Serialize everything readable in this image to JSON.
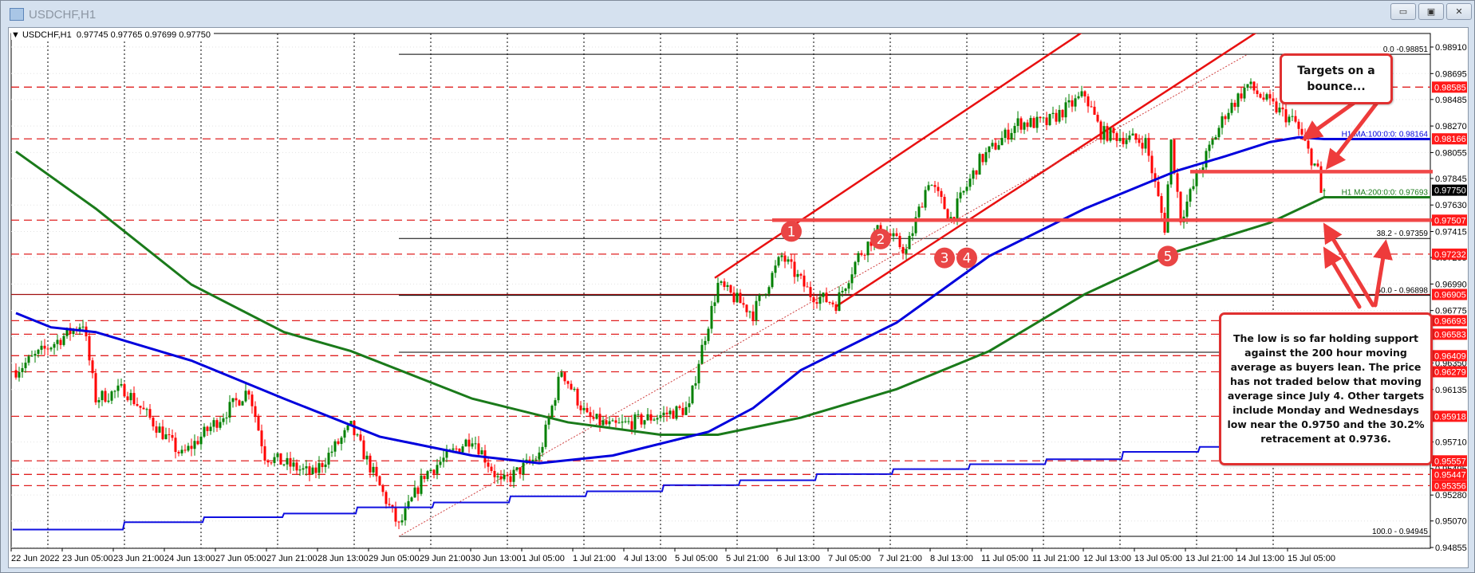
{
  "window": {
    "title": "USDCHF,H1",
    "controls": {
      "minimize": "▭",
      "restore": "▣",
      "close": "✕"
    }
  },
  "header": {
    "arrow": "▼",
    "symbol": "USDCHF,H1",
    "ohlc": "0.97745 0.97765 0.97699 0.97750"
  },
  "annotations": {
    "targets_box": [
      "Targets on a",
      "bounce..."
    ],
    "note_box": [
      "The low is so far holding support",
      "against the 200 hour moving",
      "average as buyers lean. The price",
      "has not traded below that moving",
      "average since July 4.  Other targets",
      "include Monday and Wednesdays",
      "low near the 0.9750 and the 30.2%",
      "retracement at 0.9736."
    ],
    "markers": [
      {
        "label": "1",
        "bar": 244,
        "price": 0.97416
      },
      {
        "label": "2",
        "bar": 272,
        "price": 0.97355
      },
      {
        "label": "3",
        "bar": 292,
        "price": 0.97201
      },
      {
        "label": "4",
        "bar": 299,
        "price": 0.97201
      },
      {
        "label": "5",
        "bar": 362,
        "price": 0.97216
      }
    ]
  },
  "colors": {
    "bull": "#008000",
    "bear": "#ff0000",
    "ma100": "#0000dd",
    "ma200": "#1a7a1a",
    "level": "#e02020",
    "annotation": "#ee3b3b"
  },
  "chart_data": {
    "type": "candlestick",
    "title": "USDCHF,H1",
    "ylim": [
      0.94855,
      0.9891
    ],
    "last": {
      "open": 0.97745,
      "high": 0.97765,
      "low": 0.97699,
      "close": 0.9775
    },
    "x_labels": [
      "22 Jun 2022",
      "23 Jun 05:00",
      "23 Jun 21:00",
      "24 Jun 13:00",
      "27 Jun 05:00",
      "27 Jun 21:00",
      "28 Jun 13:00",
      "29 Jun 05:00",
      "29 Jun 21:00",
      "30 Jun 13:00",
      "1 Jul 05:00",
      "1 Jul 21:00",
      "4 Jul 13:00",
      "5 Jul 05:00",
      "5 Jul 21:00",
      "6 Jul 13:00",
      "7 Jul 05:00",
      "7 Jul 21:00",
      "8 Jul 13:00",
      "11 Jul 05:00",
      "11 Jul 21:00",
      "12 Jul 13:00",
      "13 Jul 05:00",
      "13 Jul 21:00",
      "14 Jul 13:00",
      "15 Jul 05:00"
    ],
    "bars_per_label": 16,
    "y_labels": [
      "0.98910",
      "0.98695",
      "0.98485",
      "0.98270",
      "0.98055",
      "0.97845",
      "0.97630",
      "0.97415",
      "0.97205",
      "0.96990",
      "0.96775",
      "0.96565",
      "0.96350",
      "0.96135",
      "0.95920",
      "0.95710",
      "0.95495",
      "0.95280",
      "0.95070",
      "0.94855"
    ],
    "price_path": [
      [
        1,
        0.96292
      ],
      [
        22,
        0.96677
      ],
      [
        26,
        0.96061
      ],
      [
        35,
        0.96138
      ],
      [
        53,
        0.956
      ],
      [
        74,
        0.96138
      ],
      [
        79,
        0.956
      ],
      [
        94,
        0.95446
      ],
      [
        106,
        0.95831
      ],
      [
        121,
        0.95022
      ],
      [
        129,
        0.95446
      ],
      [
        144,
        0.95753
      ],
      [
        153,
        0.95369
      ],
      [
        165,
        0.956
      ],
      [
        172,
        0.96292
      ],
      [
        180,
        0.95907
      ],
      [
        188,
        0.95831
      ],
      [
        200,
        0.95907
      ],
      [
        212,
        0.95984
      ],
      [
        215,
        0.96369
      ],
      [
        221,
        0.96985
      ],
      [
        232,
        0.96754
      ],
      [
        241,
        0.97216
      ],
      [
        250,
        0.96908
      ],
      [
        258,
        0.96831
      ],
      [
        265,
        0.97216
      ],
      [
        272,
        0.97447
      ],
      [
        280,
        0.97255
      ],
      [
        287,
        0.97832
      ],
      [
        294,
        0.97524
      ],
      [
        303,
        0.97986
      ],
      [
        315,
        0.98294
      ],
      [
        324,
        0.98294
      ],
      [
        336,
        0.98525
      ],
      [
        341,
        0.98217
      ],
      [
        355,
        0.9814
      ],
      [
        361,
        0.97447
      ],
      [
        363,
        0.9814
      ],
      [
        366,
        0.97524
      ],
      [
        372,
        0.97909
      ],
      [
        380,
        0.98371
      ],
      [
        387,
        0.98602
      ],
      [
        394,
        0.98448
      ],
      [
        402,
        0.98294
      ],
      [
        406,
        0.98063
      ],
      [
        409,
        0.979
      ],
      [
        410,
        0.97717
      ],
      [
        411,
        0.9775
      ]
    ],
    "ma100": {
      "label": "H1 MA:100:0:0: 0.98164",
      "points": [
        [
          1,
          0.96754
        ],
        [
          12,
          0.96639
        ],
        [
          26,
          0.966
        ],
        [
          56,
          0.96369
        ],
        [
          85,
          0.96061
        ],
        [
          115,
          0.95753
        ],
        [
          144,
          0.956
        ],
        [
          165,
          0.95538
        ],
        [
          188,
          0.956
        ],
        [
          218,
          0.95792
        ],
        [
          232,
          0.95984
        ],
        [
          247,
          0.96292
        ],
        [
          277,
          0.96677
        ],
        [
          306,
          0.97216
        ],
        [
          336,
          0.97601
        ],
        [
          365,
          0.97909
        ],
        [
          380,
          0.98025
        ],
        [
          394,
          0.9814
        ],
        [
          403,
          0.98179
        ],
        [
          411,
          0.98164
        ]
      ]
    },
    "ma200": {
      "label": "H1 MA:200:0:0: 0.97693",
      "points": [
        [
          1,
          0.98063
        ],
        [
          26,
          0.97601
        ],
        [
          56,
          0.96985
        ],
        [
          85,
          0.966
        ],
        [
          106,
          0.96446
        ],
        [
          144,
          0.96061
        ],
        [
          174,
          0.95869
        ],
        [
          203,
          0.95769
        ],
        [
          221,
          0.95769
        ],
        [
          247,
          0.95907
        ],
        [
          277,
          0.96138
        ],
        [
          306,
          0.96446
        ],
        [
          336,
          0.96908
        ],
        [
          365,
          0.97255
        ],
        [
          394,
          0.97486
        ],
        [
          411,
          0.97693
        ]
      ]
    },
    "step_line": [
      [
        0,
        0.95
      ],
      [
        35,
        0.9506
      ],
      [
        60,
        0.951
      ],
      [
        85,
        0.9513
      ],
      [
        108,
        0.9518
      ],
      [
        132,
        0.9522
      ],
      [
        156,
        0.9527
      ],
      [
        180,
        0.9531
      ],
      [
        204,
        0.9536
      ],
      [
        228,
        0.954
      ],
      [
        252,
        0.9545
      ],
      [
        276,
        0.9549
      ],
      [
        300,
        0.9553
      ],
      [
        324,
        0.9557
      ],
      [
        348,
        0.9563
      ],
      [
        372,
        0.9567
      ],
      [
        396,
        0.9572
      ]
    ],
    "levels": [
      "0.98585",
      "0.98166",
      "0.97507",
      "0.97232",
      "0.96905",
      "0.96693",
      "0.96583",
      "0.96409",
      "0.96279",
      "0.95918",
      "0.95557",
      "0.95447",
      "0.95356"
    ],
    "current_price": "0.97750",
    "fib": [
      {
        "label": "0.0 -0.98851",
        "price": 0.98851
      },
      {
        "label": "38.2 - 0.97359",
        "price": 0.97359
      },
      {
        "label": "50.0 - 0.96898",
        "price": 0.96898
      },
      {
        "label": "",
        "price": 0.96437
      },
      {
        "label": "100.0 - 0.94945",
        "price": 0.94945
      }
    ],
    "thick_levels": [
      {
        "price": 0.97507,
        "from_bar": 238
      },
      {
        "price": 0.979,
        "from_bar": 369
      }
    ],
    "trend_lines": [
      {
        "style": "channel",
        "from": [
          220,
          0.97039
        ],
        "to": [
          338,
          0.99079
        ]
      },
      {
        "style": "channel",
        "from": [
          258,
          0.96808
        ],
        "to": [
          391,
          0.99049
        ]
      },
      {
        "style": "dotted",
        "from": [
          121,
          0.94945
        ],
        "to": [
          387,
          0.98851
        ]
      }
    ]
  }
}
